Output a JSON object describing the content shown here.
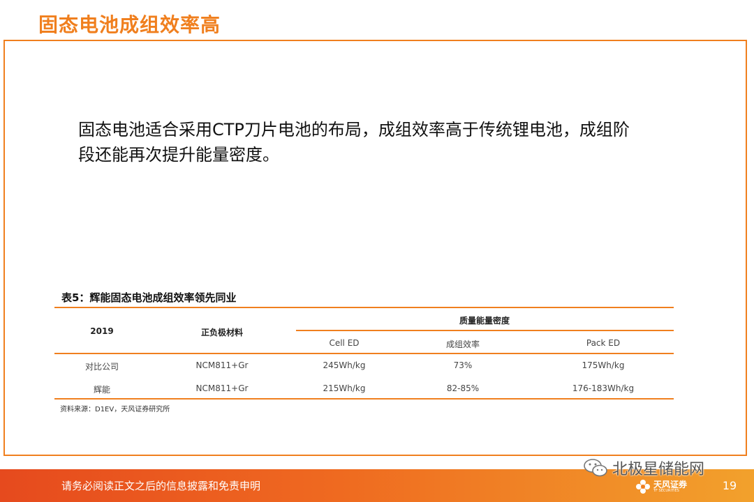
{
  "slide": {
    "title": "固态电池成组效率高",
    "body": "固态电池适合采用CTP刀片电池的布局，成组效率高于传统锂电池，成组阶段还能再次提升能量密度。"
  },
  "table": {
    "caption": "表5：辉能固态电池成组效率领先同业",
    "headers": {
      "year": "2019",
      "material": "正负极材料",
      "group": "质量能量密度",
      "cell_ed": "Cell ED",
      "efficiency": "成组效率",
      "pack_ed": "Pack ED"
    },
    "rows": [
      {
        "name": "对比公司",
        "material": "NCM811+Gr",
        "cell_ed": "245Wh/kg",
        "efficiency": "73%",
        "pack_ed": "175Wh/kg"
      },
      {
        "name": "辉能",
        "material": "NCM811+Gr",
        "cell_ed": "215Wh/kg",
        "efficiency": "82-85%",
        "pack_ed": "176-183Wh/kg"
      }
    ],
    "source": "资料来源：D1EV，天风证券研究所"
  },
  "footer": {
    "disclaimer": "请务必阅读正文之后的信息披露和免责申明",
    "watermark": "北极星储能网",
    "logo_cn": "天风证券",
    "logo_en": "TF SECURITIES",
    "page_number": "19"
  },
  "colors": {
    "accent": "#f07f1e",
    "footer_start": "#e64a1e",
    "footer_end": "#f2a12c"
  }
}
